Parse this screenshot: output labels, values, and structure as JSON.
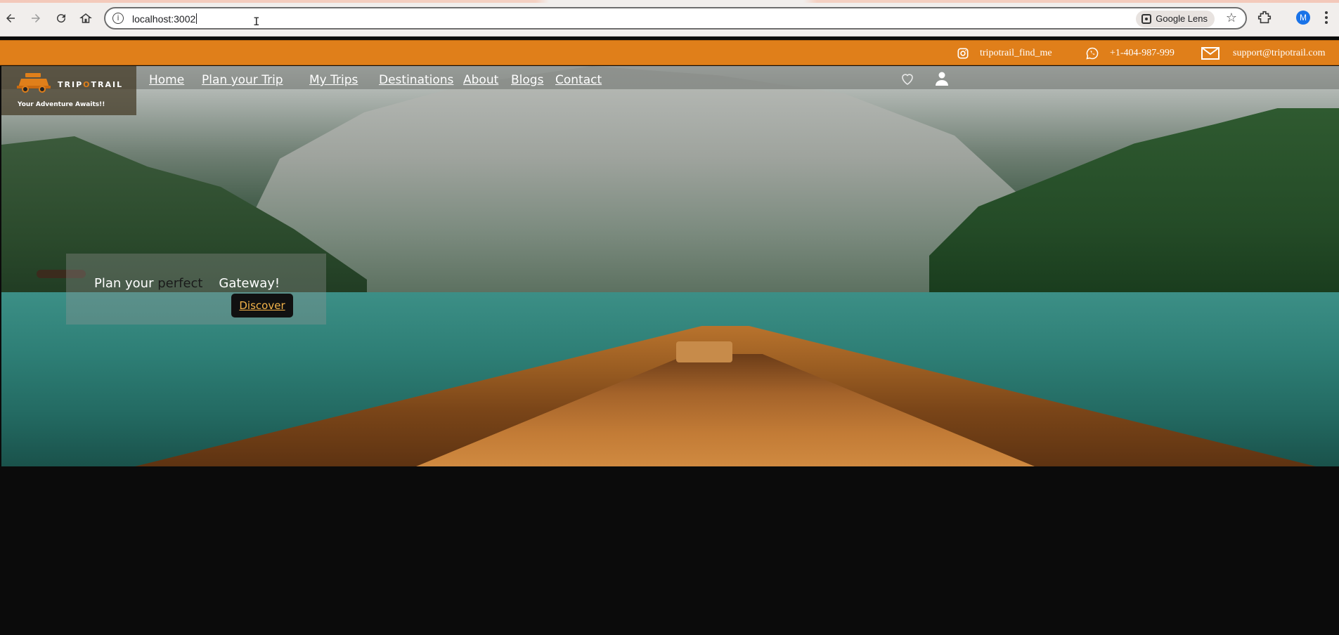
{
  "browser": {
    "url": "localhost:3002",
    "lens_label": "Google Lens",
    "profile_initial": "M"
  },
  "contact_bar": {
    "instagram": "tripotrail_find_me",
    "phone": "+1-404-987-999",
    "email": "support@tripotrail.com"
  },
  "brand": {
    "name_part1": "TRIP",
    "name_o": "O",
    "name_part2": "TRAIL",
    "tagline": "Your Adventure Awaits!!"
  },
  "nav": {
    "items": [
      "Home",
      "Plan your Trip",
      "My Trips",
      "Destinations",
      "About",
      "Blogs",
      "Contact"
    ]
  },
  "hero": {
    "title_part1": "Plan your ",
    "title_highlight": "perfect",
    "title_part2": "    Gateway!",
    "button_label": "Discover"
  },
  "colors": {
    "accent": "#e07f1a",
    "page_bg": "#0b0b0b"
  }
}
